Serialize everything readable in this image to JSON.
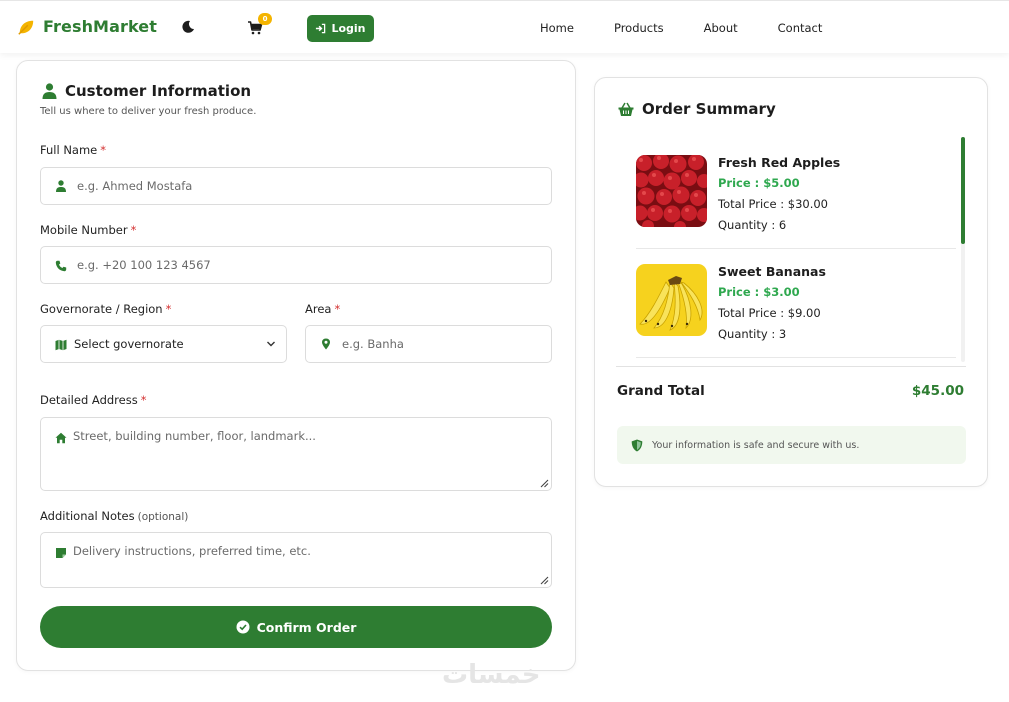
{
  "colors": {
    "brand": "#2e7d32",
    "price": "#2fa84f",
    "required": "#d32f2f",
    "badge": "#f4b400"
  },
  "navbar": {
    "brand": "FreshMarket",
    "brand_icon": "leaf-icon",
    "theme_icon": "moon-icon",
    "cart_icon": "cart-icon",
    "cart_count": "0",
    "login_label": "Login",
    "links": [
      "Home",
      "Products",
      "About",
      "Contact"
    ]
  },
  "customer": {
    "title": "Customer Information",
    "subtitle": "Tell us where to deliver your fresh produce.",
    "required_mark": "*",
    "full_name": {
      "label": "Full Name",
      "placeholder": "e.g. Ahmed Mostafa"
    },
    "mobile": {
      "label": "Mobile Number",
      "placeholder": "e.g. +20 100 123 4567"
    },
    "governorate": {
      "label": "Governorate / Region",
      "value": "Select governorate"
    },
    "area": {
      "label": "Area",
      "placeholder": "e.g. Banha"
    },
    "address": {
      "label": "Detailed Address",
      "placeholder": "Street, building number, floor, landmark..."
    },
    "notes": {
      "label": "Additional Notes",
      "optional": "(optional)",
      "placeholder": "Delivery instructions, preferred time, etc."
    },
    "confirm_label": "Confirm Order"
  },
  "summary": {
    "title": "Order Summary",
    "items": [
      {
        "name": "Fresh Red Apples",
        "price": "Price : $5.00",
        "total": "Total Price : $30.00",
        "qty": "Quantity : 6",
        "image": "apples"
      },
      {
        "name": "Sweet Bananas",
        "price": "Price : $3.00",
        "total": "Total Price : $9.00",
        "qty": "Quantity : 3",
        "image": "bananas"
      }
    ],
    "grand_label": "Grand Total",
    "grand_value": "$45.00",
    "secure_text": "Your information is safe and secure with us."
  },
  "watermark": "خمسات"
}
